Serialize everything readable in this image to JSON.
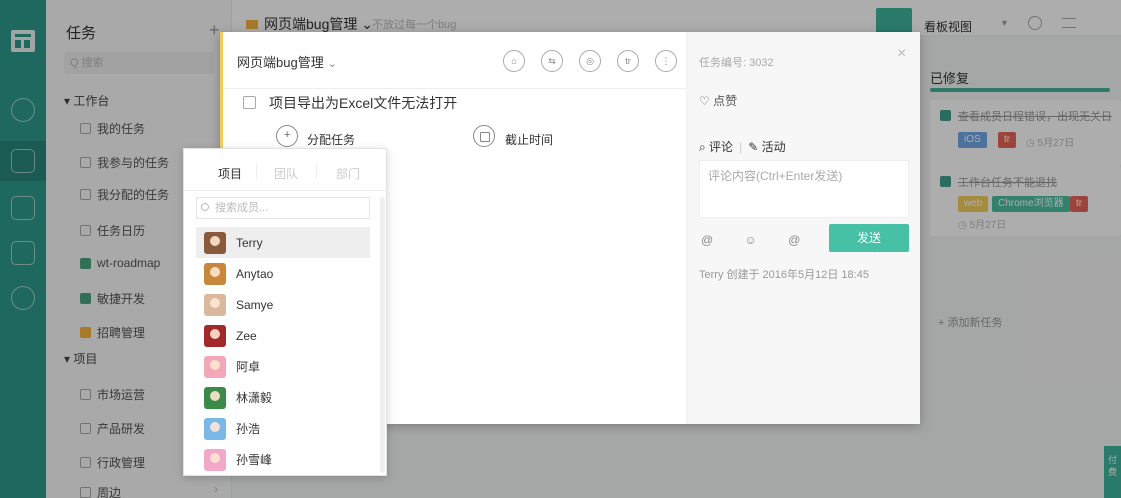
{
  "sidebar": {
    "title": "任务",
    "add": "+",
    "search_placeholder": "Q 搜索",
    "workspace_group": "▾ 工作台",
    "workspace_items": [
      "我的任务",
      "我参与的任务",
      "我分配的任务",
      "任务日历",
      "wt-roadmap",
      "敏捷开发",
      "招聘管理"
    ],
    "project_group": "▾ 项目",
    "project_items": [
      "市场运营",
      "产品研发",
      "行政管理",
      "周边"
    ],
    "more": "›"
  },
  "header": {
    "project_title": "网页端bug管理 ⌄",
    "subtitle": "不放过每一个bug",
    "view": "看板视图",
    "view_arrow": "▾"
  },
  "board": {
    "column_title": "已修复",
    "cards": [
      {
        "title": "查看成员日程错误，出现无关日",
        "tags": [
          {
            "text": "iOS",
            "color": "#6fa7e6"
          },
          {
            "text": "tr",
            "color": "#e8665a"
          }
        ],
        "date": "◷ 5月27日"
      },
      {
        "title": "工作台任务不能退找",
        "tags": [
          {
            "text": "web",
            "color": "#f3cd5a"
          },
          {
            "text": "Chrome浏览器",
            "color": "#4cbda0"
          },
          {
            "text": "tr",
            "color": "#e8665a"
          }
        ],
        "date": "◷ 5月27日"
      }
    ],
    "add_task": "+ 添加新任务",
    "side_tab": "付费"
  },
  "modal": {
    "project": "网页端bug管理",
    "project_arrow": "⌄",
    "tool_icons": [
      "⌂",
      "⇆",
      "◎",
      "tr",
      "⋮"
    ],
    "task_title": "项目导出为Excel文件无法打开",
    "assign_label": "分配任务",
    "due_label": "截止时间",
    "task_number": "任务编号: 3032",
    "close": "×",
    "like": "♡ 点赞",
    "tab_comment": "⌕ 评论",
    "tab_separator": "|",
    "tab_activity": "✎ 活动",
    "comment_placeholder": "评论内容(Ctrl+Enter发送)",
    "comment_icons": "@ ☺ @",
    "send": "发送",
    "meta": "Terry  创建于 2016年5月12日 18:45"
  },
  "dropdown": {
    "tabs": [
      "项目",
      "团队",
      "部门"
    ],
    "search_placeholder": "搜索成员...",
    "members": [
      {
        "name": "Terry",
        "color": "#8a5a3c"
      },
      {
        "name": "Anytao",
        "color": "#c9873c"
      },
      {
        "name": "Samye",
        "color": "#d9b89c"
      },
      {
        "name": "Zee",
        "color": "#a22a2a"
      },
      {
        "name": "阿卓",
        "color": "#f2a8b8"
      },
      {
        "name": "林潇毅",
        "color": "#3a8a4a"
      },
      {
        "name": "孙浩",
        "color": "#7ab8e8"
      },
      {
        "name": "孙雪峰",
        "color": "#f2a8c8"
      }
    ]
  }
}
